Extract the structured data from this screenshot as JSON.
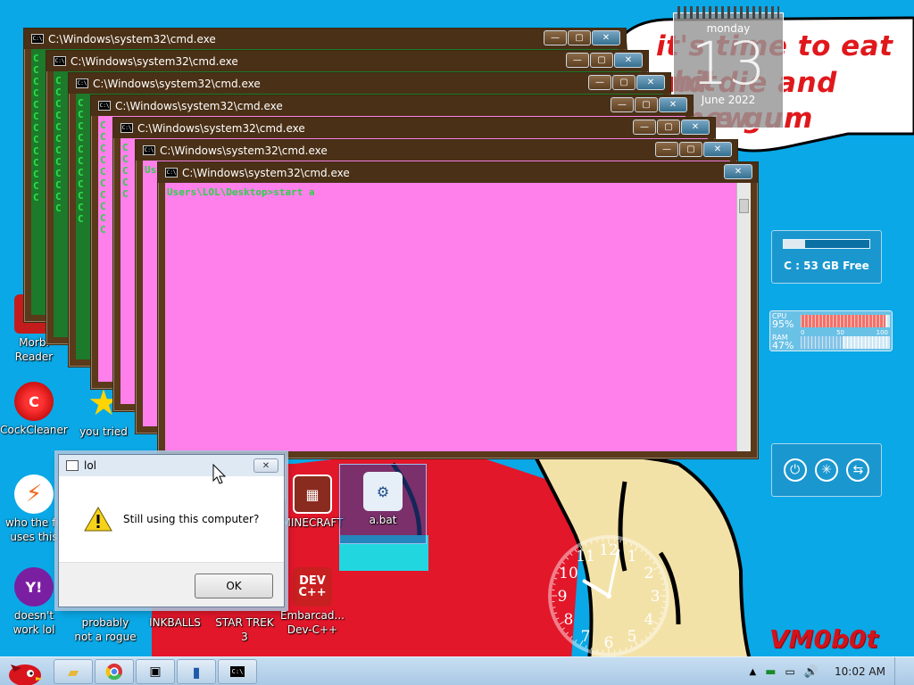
{
  "wallpaper": {
    "line1": "it's time to eat shit",
    "line2": "nd die and chew",
    "line3": "e gum",
    "signature": "VM0b0t"
  },
  "desktop_icons": [
    {
      "id": "morbi",
      "label_line1": "Morbi",
      "label_line2": "Reader",
      "icon": "reader-icon"
    },
    {
      "id": "cockcleaner",
      "label_line1": "CockCleaner",
      "label_line2": "",
      "icon": "cleaner-icon"
    },
    {
      "id": "you-tried",
      "label_line1": "you tried",
      "label_line2": "",
      "icon": "star-icon"
    },
    {
      "id": "who-the-fu",
      "label_line1": "who the fu",
      "label_line2": "uses this",
      "icon": "flash-icon"
    },
    {
      "id": "minecraft",
      "label_line1": "MINECRAFT",
      "label_line2": "",
      "icon": "minecraft-icon"
    },
    {
      "id": "a-bat",
      "label_line1": "a.bat",
      "label_line2": "",
      "icon": "batch-file-icon"
    },
    {
      "id": "doesnt-work",
      "label_line1": "doesn't",
      "label_line2": "work lol",
      "icon": "yahoo-icon"
    },
    {
      "id": "probably",
      "label_line1": "probably",
      "label_line2": "not a rogue",
      "icon": "rogue-icon"
    },
    {
      "id": "inkballs",
      "label_line1": "INKBALLS",
      "label_line2": "",
      "icon": "ink-icon"
    },
    {
      "id": "star-trek",
      "label_line1": "STAR TREK",
      "label_line2": "3",
      "icon": "star-trek-icon"
    },
    {
      "id": "devcpp",
      "label_line1": "Embarcad...",
      "label_line2": "Dev-C++",
      "icon": "devcpp-icon"
    }
  ],
  "cmd_windows": [
    {
      "title": "C:\\Windows\\system32\\cmd.exe",
      "text": "C\nC\nC\nC\nC\nC\nC\nC\nC\nC\nC\nC\nC",
      "style": "green"
    },
    {
      "title": "C:\\Windows\\system32\\cmd.exe",
      "text": "C\nC\nC\nC\nC\nC\nC\nC\nC\nC\nC\nC",
      "style": "green"
    },
    {
      "title": "C:\\Windows\\system32\\cmd.exe",
      "text": "C\nC\nC\nC\nC\nC\nC\nC\nC\nC\nC",
      "style": "green"
    },
    {
      "title": "C:\\Windows\\system32\\cmd.exe",
      "text": "C\nC\nC\nC\nC\nC\nC\nC\nC\nC",
      "style": "pink"
    },
    {
      "title": "C:\\Windows\\system32\\cmd.exe",
      "text": "C\nC\nC\nC\nC",
      "style": "pink"
    },
    {
      "title": "C:\\Windows\\system32\\cmd.exe",
      "text": "Us",
      "style": "pink"
    },
    {
      "title": "C:\\Windows\\system32\\cmd.exe",
      "text": "Users\\LOL\\Desktop>start a",
      "style": "pink"
    }
  ],
  "window_buttons": {
    "minimize": "—",
    "maximize": "▢",
    "close": "✕"
  },
  "calendar": {
    "day": "monday",
    "date": "13",
    "month": "June 2022"
  },
  "disk": {
    "label": "C : 53 GB Free",
    "used_fraction": 0.25
  },
  "cpu_meter": {
    "cpu_label": "CPU",
    "cpu_value": "95%",
    "cpu_fraction": 0.95,
    "ram_label": "RAM",
    "ram_value": "47%",
    "ram_fraction": 0.47,
    "scale": [
      "0",
      "50",
      "100"
    ]
  },
  "controls": [
    {
      "icon": "power-icon"
    },
    {
      "icon": "settings-icon"
    },
    {
      "icon": "switch-icon"
    }
  ],
  "analog_clock": {
    "numbers": [
      "12",
      "1",
      "2",
      "3",
      "4",
      "5",
      "6",
      "7",
      "8",
      "9",
      "10",
      "11"
    ],
    "hour": 10,
    "minute": 2
  },
  "message_box": {
    "title": "lol",
    "message": "Still using this computer?",
    "ok_label": "OK"
  },
  "taskbar": {
    "time": "10:02 AM",
    "buttons": [
      {
        "name": "explorer-icon",
        "glyph": "📁"
      },
      {
        "name": "chrome-icon",
        "glyph": "●"
      },
      {
        "name": "monitor-icon",
        "glyph": "▣"
      },
      {
        "name": "book-icon",
        "glyph": "▮"
      },
      {
        "name": "cmd-icon",
        "glyph": "C:\\"
      }
    ]
  }
}
